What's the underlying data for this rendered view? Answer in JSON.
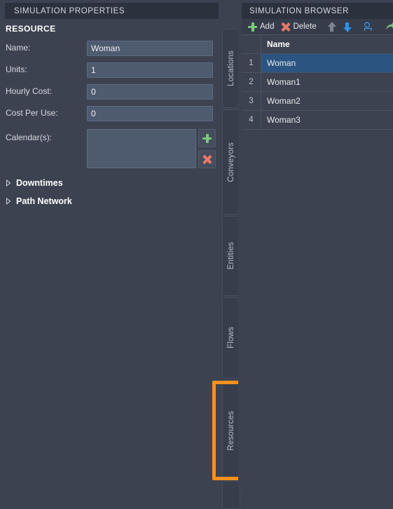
{
  "properties_panel": {
    "title": "SIMULATION PROPERTIES",
    "section_heading": "RESOURCE",
    "fields": [
      {
        "label": "Name:",
        "value": "Woman"
      },
      {
        "label": "Units:",
        "value": "1"
      },
      {
        "label": "Hourly Cost:",
        "value": "0"
      },
      {
        "label": "Cost Per Use:",
        "value": "0"
      }
    ],
    "calendars": {
      "label": "Calendar(s):",
      "value": "",
      "add_button": "add-calendar",
      "delete_button": "delete-calendar"
    },
    "expanders": [
      {
        "label": "Downtimes",
        "expanded": false
      },
      {
        "label": "Path Network",
        "expanded": false
      }
    ]
  },
  "tabstrip": {
    "tabs": [
      {
        "label": "Locations",
        "selected": false
      },
      {
        "label": "Conveyors",
        "selected": false
      },
      {
        "label": "Entities",
        "selected": false
      },
      {
        "label": "Flows",
        "selected": false
      },
      {
        "label": "Resources",
        "selected": true
      }
    ],
    "highlight_color": "#f7911e"
  },
  "browser_panel": {
    "title": "SIMULATION BROWSER",
    "toolbar": {
      "add_label": "Add",
      "delete_label": "Delete",
      "move_up": "move-up",
      "move_down": "move-down",
      "duplicate": "duplicate-resource",
      "goto": "go-to"
    },
    "table": {
      "columns": [
        "",
        "Name"
      ],
      "rows": [
        {
          "index": "1",
          "name": "Woman",
          "selected": true
        },
        {
          "index": "2",
          "name": "Woman1",
          "selected": false
        },
        {
          "index": "3",
          "name": "Woman2",
          "selected": false
        },
        {
          "index": "4",
          "name": "Woman3",
          "selected": false
        }
      ]
    }
  },
  "colors": {
    "background": "#3c4250",
    "titlebar": "#2b313d",
    "input": "#4e5a6e",
    "selection": "#2c5480",
    "accent_orange": "#f7911e",
    "add_green": "#79c97e",
    "delete_red": "#e8796c",
    "arrow_blue": "#2e90e8"
  }
}
